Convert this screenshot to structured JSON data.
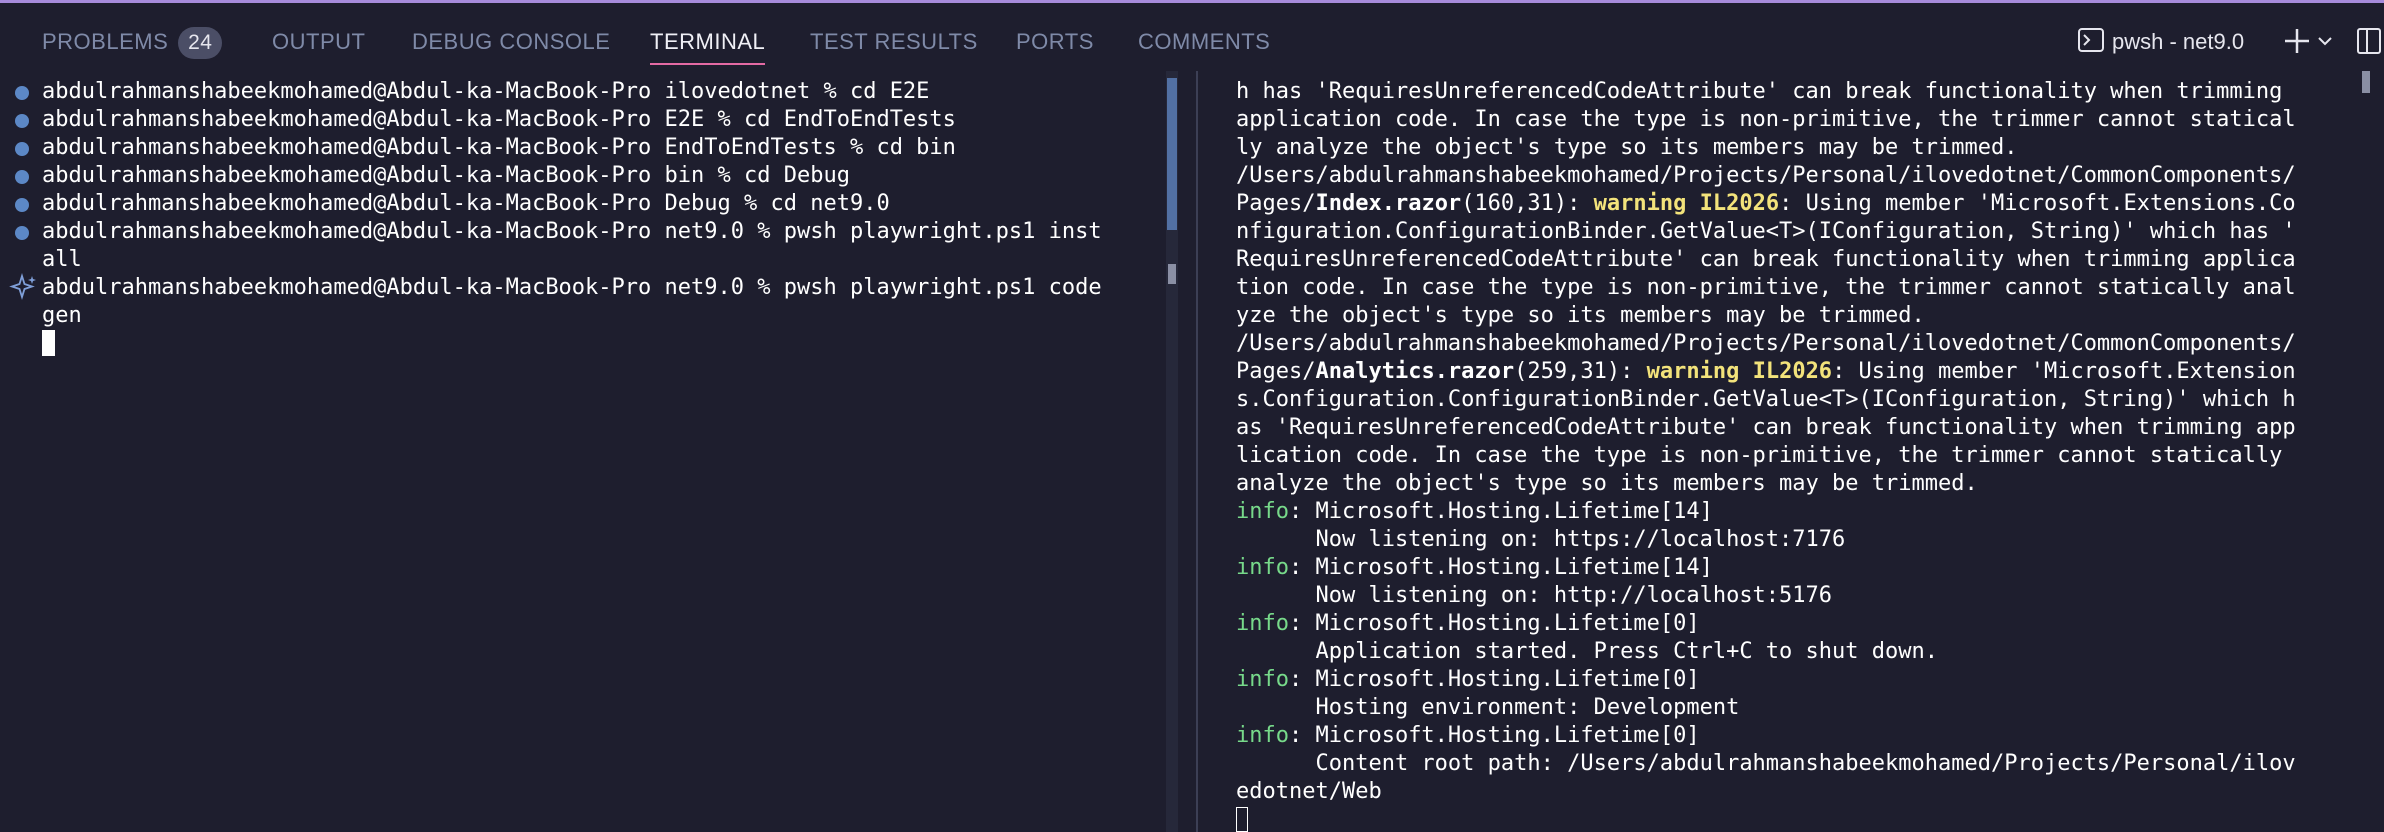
{
  "panel": {
    "tabs": [
      {
        "label": "PROBLEMS",
        "badge": "24"
      },
      {
        "label": "OUTPUT"
      },
      {
        "label": "DEBUG CONSOLE"
      },
      {
        "label": "TERMINAL",
        "active": true
      },
      {
        "label": "TEST RESULTS"
      },
      {
        "label": "PORTS"
      },
      {
        "label": "COMMENTS"
      }
    ],
    "terminal_name": "pwsh - net9.0",
    "icons": [
      "terminal-icon",
      "plus-icon",
      "chevron-down-icon",
      "split-layout-icon"
    ]
  },
  "left_terminal": {
    "lines": [
      "abdulrahmanshabeekmohamed@Abdul-ka-MacBook-Pro ilovedotnet % cd E2E",
      "abdulrahmanshabeekmohamed@Abdul-ka-MacBook-Pro E2E % cd EndToEndTests",
      "abdulrahmanshabeekmohamed@Abdul-ka-MacBook-Pro EndToEndTests % cd bin",
      "abdulrahmanshabeekmohamed@Abdul-ka-MacBook-Pro bin % cd Debug",
      "abdulrahmanshabeekmohamed@Abdul-ka-MacBook-Pro Debug % cd net9.0",
      "abdulrahmanshabeekmohamed@Abdul-ka-MacBook-Pro net9.0 % pwsh playwright.ps1 inst",
      "all",
      "abdulrahmanshabeekmohamed@Abdul-ka-MacBook-Pro net9.0 % pwsh playwright.ps1 code",
      "gen"
    ]
  },
  "right_terminal": {
    "l1": "h has 'RequiresUnreferencedCodeAttribute' can break functionality when trimming ",
    "l2": "application code. In case the type is non-primitive, the trimmer cannot statical",
    "l3": "ly analyze the object's type so its members may be trimmed.",
    "l4": "/Users/abdulrahmanshabeekmohamed/Projects/Personal/ilovedotnet/CommonComponents/",
    "l5_pre": "Pages/",
    "l5_file": "Index.razor",
    "l5_pos": "(160,31): ",
    "l5_warning": "warning IL2026",
    "l5_post": ": Using member 'Microsoft.Extensions.Co",
    "l6": "nfiguration.ConfigurationBinder.GetValue<T>(IConfiguration, String)' which has '",
    "l7": "RequiresUnreferencedCodeAttribute' can break functionality when trimming applica",
    "l8": "tion code. In case the type is non-primitive, the trimmer cannot statically anal",
    "l9": "yze the object's type so its members may be trimmed.",
    "l10": "/Users/abdulrahmanshabeekmohamed/Projects/Personal/ilovedotnet/CommonComponents/",
    "l11_pre": "Pages/",
    "l11_file": "Analytics.razor",
    "l11_pos": "(259,31): ",
    "l11_warning": "warning IL2026",
    "l11_post": ": Using member 'Microsoft.Extension",
    "l12": "s.Configuration.ConfigurationBinder.GetValue<T>(IConfiguration, String)' which h",
    "l13": "as 'RequiresUnreferencedCodeAttribute' can break functionality when trimming app",
    "l14": "lication code. In case the type is non-primitive, the trimmer cannot statically ",
    "l15": "analyze the object's type so its members may be trimmed.",
    "info_label": "info",
    "i1_head": ": Microsoft.Hosting.Lifetime[14]",
    "i1_body": "      Now listening on: https://localhost:7176",
    "i2_head": ": Microsoft.Hosting.Lifetime[14]",
    "i2_body": "      Now listening on: http://localhost:5176",
    "i3_head": ": Microsoft.Hosting.Lifetime[0]",
    "i3_body": "      Application started. Press Ctrl+C to shut down.",
    "i4_head": ": Microsoft.Hosting.Lifetime[0]",
    "i4_body": "      Hosting environment: Development",
    "i5_head": ": Microsoft.Hosting.Lifetime[0]",
    "i5_body": "      Content root path: /Users/abdulrahmanshabeekmohamed/Projects/Personal/ilov",
    "i5_wrap": "edotnet/Web"
  },
  "colors": {
    "accent_underline": "#e46aa4",
    "warning": "#f3e37b",
    "info": "#77d98a",
    "prompt_dot": "#5c88c6"
  }
}
